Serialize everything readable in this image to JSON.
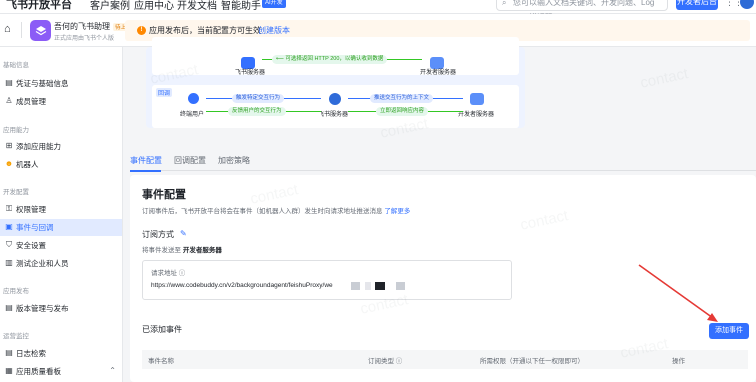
{
  "topbar": {
    "brand": "飞书开放平台",
    "nav": [
      "客户案例",
      "应用中心",
      "开发文档",
      "智能助手"
    ],
    "ai_badge": "AI开发",
    "search_placeholder": "您可以输入文档关键词、开发问题、Log ID、错误码",
    "developer_button": "开发者后台"
  },
  "app": {
    "name": "吾何的飞书助理",
    "tag": "待上线",
    "description": "正式应用由飞书个人版"
  },
  "notice": {
    "text": "应用发布后，当前配置方可生效",
    "link": "创建版本"
  },
  "sidebar": {
    "groups": [
      {
        "title": "基础信息",
        "items": [
          {
            "label": "凭证与基础信息",
            "icon": "document-icon"
          },
          {
            "label": "成员管理",
            "icon": "person-icon"
          }
        ]
      },
      {
        "title": "应用能力",
        "items": [
          {
            "label": "添加应用能力",
            "icon": "grid-plus-icon"
          },
          {
            "label": "机器人",
            "icon": "robot-icon"
          }
        ]
      },
      {
        "title": "开发配置",
        "items": [
          {
            "label": "权限管理",
            "icon": "key-icon"
          },
          {
            "label": "事件与回调",
            "icon": "event-icon",
            "active": true
          },
          {
            "label": "安全设置",
            "icon": "shield-icon"
          },
          {
            "label": "测试企业和人员",
            "icon": "test-icon"
          }
        ]
      },
      {
        "title": "应用发布",
        "items": [
          {
            "label": "版本管理与发布",
            "icon": "version-icon"
          }
        ]
      },
      {
        "title": "运营监控",
        "items": [
          {
            "label": "日志检索",
            "icon": "log-icon"
          },
          {
            "label": "应用质量看板",
            "icon": "chart-icon"
          }
        ]
      }
    ]
  },
  "diagram": {
    "top_row": {
      "left_label": "飞书服务器",
      "right_label": "开发者服务器",
      "green_pill": "⟵ 可选择返回 HTTP 200，以确认收到数据"
    },
    "bottom_row": {
      "tag": "回调",
      "user_label": "终端用户",
      "server_label": "飞书服务器",
      "dev_label": "开发者服务器",
      "pill_1": "触发特定交互行为",
      "pill_2": "反馈用户的交互行为",
      "pill_3": "推送交互行为的上下文",
      "pill_4": "立即返回响应内容"
    }
  },
  "tabs": [
    "事件配置",
    "回调配置",
    "加密策略"
  ],
  "event_config": {
    "title": "事件配置",
    "description": "订阅事件后，飞书开放平台将会在事件（如机器人入群）发生时向请求地址推送消息",
    "more_link": "了解更多",
    "subscribe_title": "订阅方式",
    "subscribe_desc_prefix": "将事件发送至",
    "subscribe_desc_target": "开发者服务器",
    "url_label": "请求地址 ⓘ",
    "url_value": "https://www.codebuddy.cn/v2/backgroundagent/feishuProxy/we"
  },
  "added_events": {
    "title": "已添加事件",
    "add_button": "添加事件",
    "columns": [
      "事件名称",
      "订阅类型 ⓘ",
      "所需权限（开通以下任一权限即可）",
      "操作"
    ]
  },
  "watermark": "contact"
}
